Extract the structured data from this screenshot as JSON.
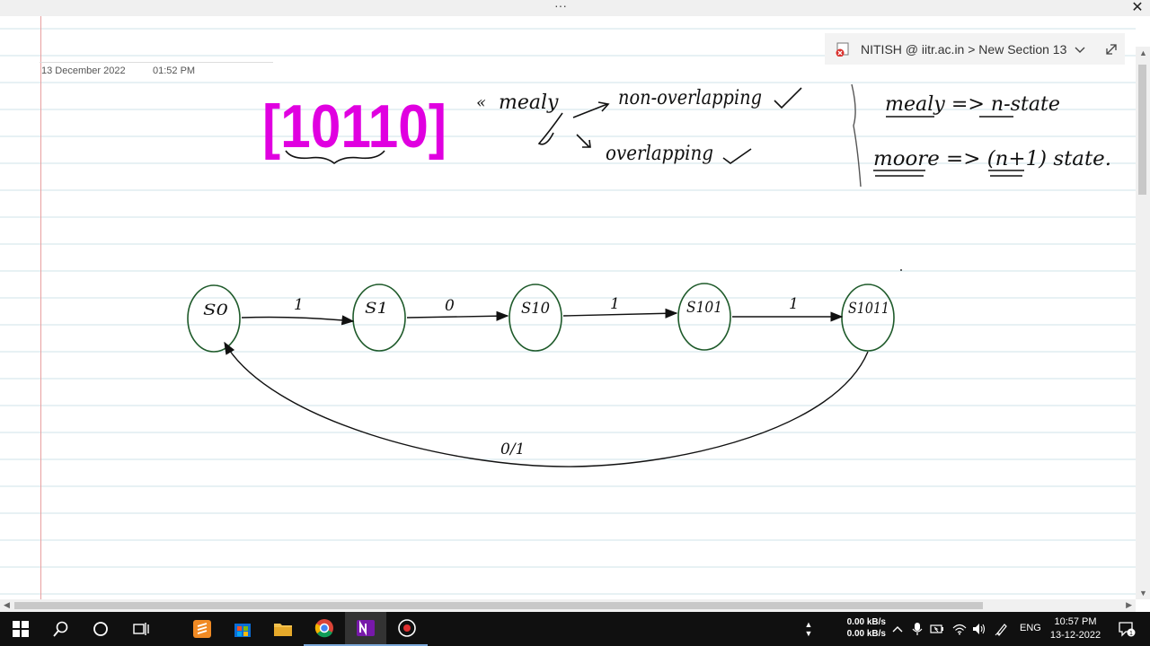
{
  "window": {
    "menu_dots": "···",
    "close": "✕"
  },
  "note": {
    "date": "13 December 2022",
    "time": "01:52 PM"
  },
  "breadcrumb": {
    "text": "NITISH @ iitr.ac.in > New Section 13",
    "icon": "section-icon",
    "chevron": "chevron-down-icon",
    "expand": "expand-icon"
  },
  "ink": {
    "sequence": "[10110]",
    "sequence_color": "#e000e0",
    "ink_color": "#111111",
    "machine_color": "#1e5a2a",
    "branch_mealy": "mealy",
    "branch_non_overlapping": "non-overlapping",
    "branch_overlapping": "overlapping",
    "rule_mealy": "mealy => n-state",
    "rule_moore": "moore => (n+1) state."
  },
  "diagram": {
    "states": [
      "S0",
      "S1",
      "S10",
      "S101",
      "S1011"
    ],
    "transitions": [
      "1",
      "0",
      "1",
      "1"
    ],
    "return_label": "0/1"
  },
  "taskbar": {
    "net_up": "0.00 kB/s",
    "net_down": "0.00 kB/s",
    "language": "ENG",
    "time": "10:57 PM",
    "date": "13-12-2022",
    "notification_count": "1"
  }
}
